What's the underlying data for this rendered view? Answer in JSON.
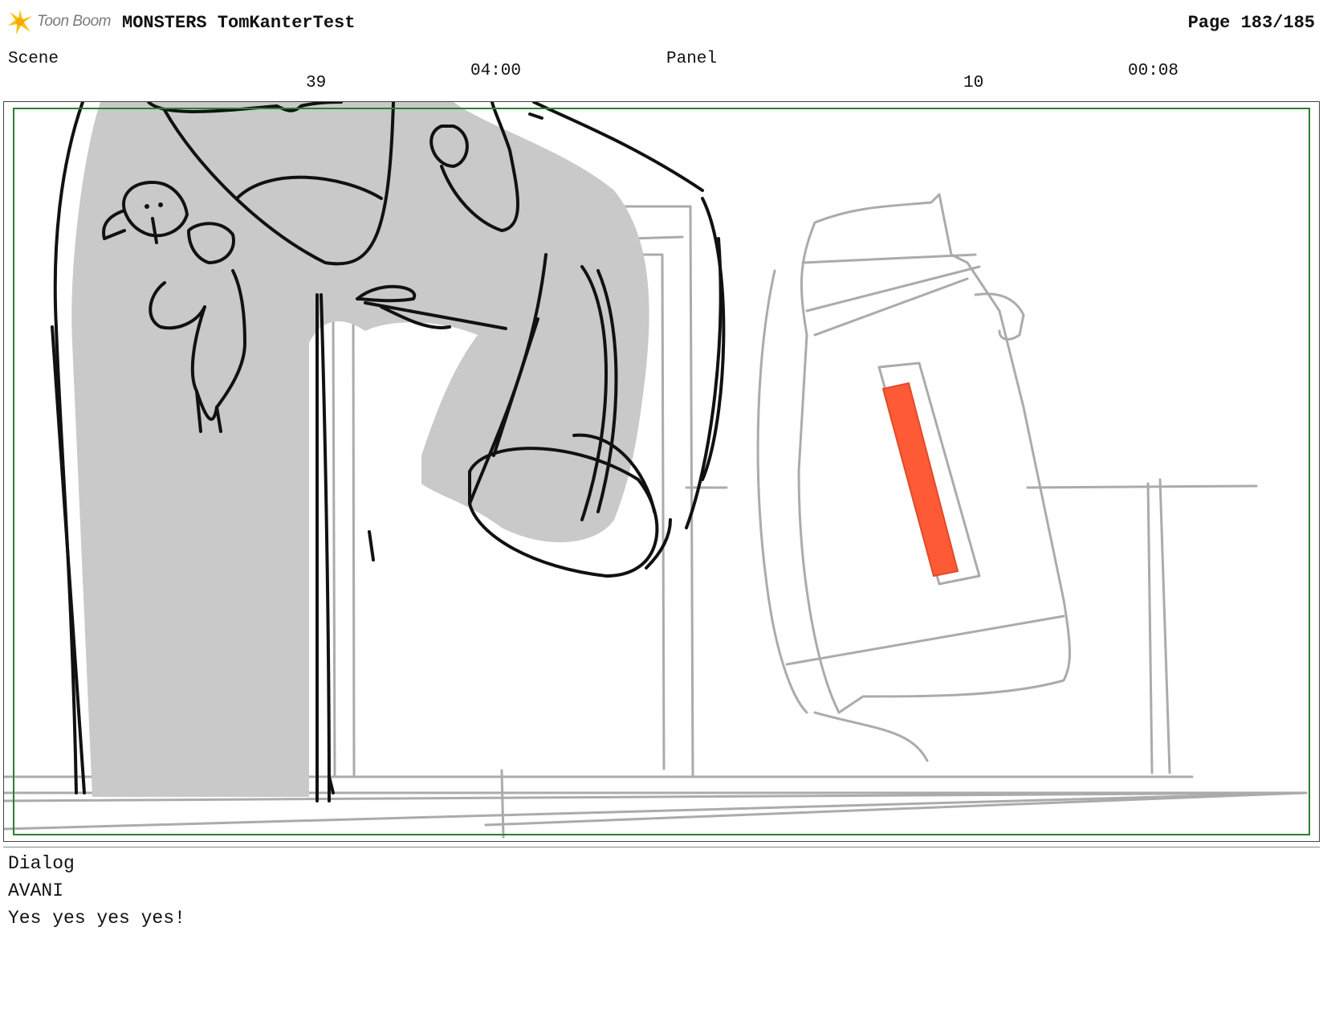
{
  "header": {
    "brand": "Toon Boom",
    "brand_icon": "star-burst-icon",
    "brand_color": "#f5c518",
    "project_title": "MONSTERS TomKanterTest",
    "page": "Page 183/185"
  },
  "meta": {
    "scene_label": "Scene",
    "scene_number": "39",
    "scene_duration": "04:00",
    "panel_label": "Panel",
    "panel_number": "10",
    "panel_duration": "00:08"
  },
  "frame": {
    "safe_area_color": "#2e7d32",
    "accent_color": "#ff5a36"
  },
  "dialog": {
    "label": "Dialog",
    "character": "AVANI",
    "line": "Yes yes yes yes!"
  }
}
